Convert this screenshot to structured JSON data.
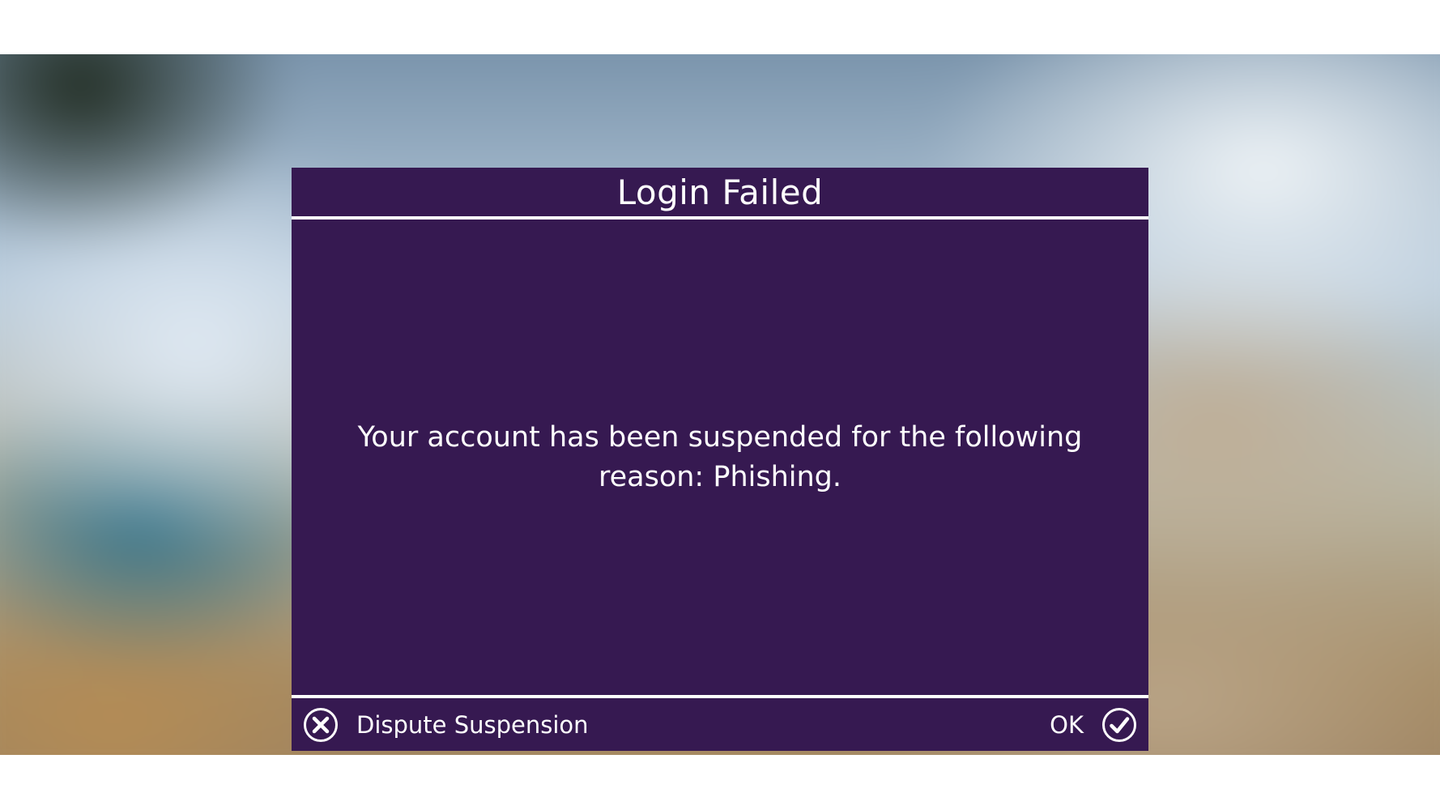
{
  "dialog": {
    "title": "Login Failed",
    "message": "Your account has been suspended for the following reason: Phishing.",
    "buttons": {
      "dispute_label": "Dispute Suspension",
      "dispute_icon": "x-circle-icon",
      "ok_label": "OK",
      "ok_icon": "check-circle-icon"
    }
  },
  "colors": {
    "dialog_background": "#361951",
    "text": "#ffffff",
    "divider": "#ffffff"
  }
}
